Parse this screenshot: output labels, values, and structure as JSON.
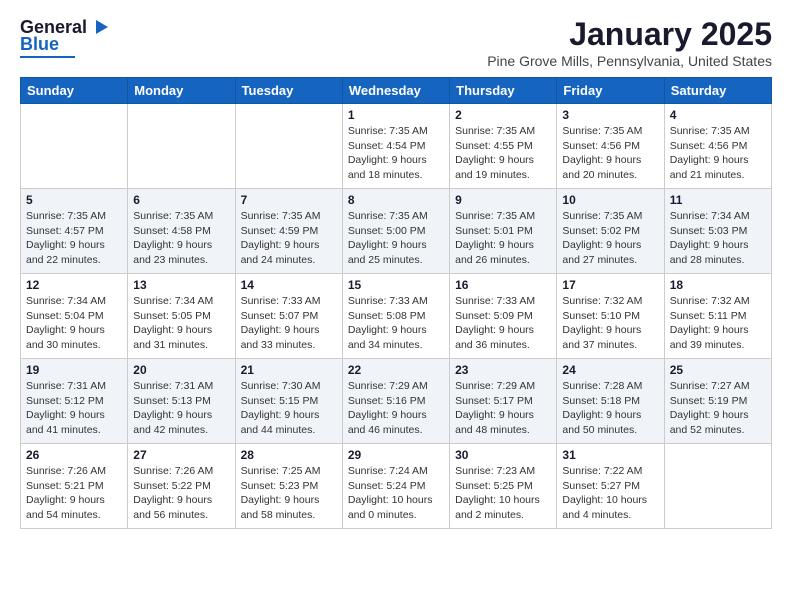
{
  "header": {
    "logo": {
      "line1": "General",
      "line2": "Blue"
    },
    "title": "January 2025",
    "subtitle": "Pine Grove Mills, Pennsylvania, United States"
  },
  "weekdays": [
    "Sunday",
    "Monday",
    "Tuesday",
    "Wednesday",
    "Thursday",
    "Friday",
    "Saturday"
  ],
  "weeks": [
    [
      {
        "day": "",
        "info": ""
      },
      {
        "day": "",
        "info": ""
      },
      {
        "day": "",
        "info": ""
      },
      {
        "day": "1",
        "info": "Sunrise: 7:35 AM\nSunset: 4:54 PM\nDaylight: 9 hours and 18 minutes."
      },
      {
        "day": "2",
        "info": "Sunrise: 7:35 AM\nSunset: 4:55 PM\nDaylight: 9 hours and 19 minutes."
      },
      {
        "day": "3",
        "info": "Sunrise: 7:35 AM\nSunset: 4:56 PM\nDaylight: 9 hours and 20 minutes."
      },
      {
        "day": "4",
        "info": "Sunrise: 7:35 AM\nSunset: 4:56 PM\nDaylight: 9 hours and 21 minutes."
      }
    ],
    [
      {
        "day": "5",
        "info": "Sunrise: 7:35 AM\nSunset: 4:57 PM\nDaylight: 9 hours and 22 minutes."
      },
      {
        "day": "6",
        "info": "Sunrise: 7:35 AM\nSunset: 4:58 PM\nDaylight: 9 hours and 23 minutes."
      },
      {
        "day": "7",
        "info": "Sunrise: 7:35 AM\nSunset: 4:59 PM\nDaylight: 9 hours and 24 minutes."
      },
      {
        "day": "8",
        "info": "Sunrise: 7:35 AM\nSunset: 5:00 PM\nDaylight: 9 hours and 25 minutes."
      },
      {
        "day": "9",
        "info": "Sunrise: 7:35 AM\nSunset: 5:01 PM\nDaylight: 9 hours and 26 minutes."
      },
      {
        "day": "10",
        "info": "Sunrise: 7:35 AM\nSunset: 5:02 PM\nDaylight: 9 hours and 27 minutes."
      },
      {
        "day": "11",
        "info": "Sunrise: 7:34 AM\nSunset: 5:03 PM\nDaylight: 9 hours and 28 minutes."
      }
    ],
    [
      {
        "day": "12",
        "info": "Sunrise: 7:34 AM\nSunset: 5:04 PM\nDaylight: 9 hours and 30 minutes."
      },
      {
        "day": "13",
        "info": "Sunrise: 7:34 AM\nSunset: 5:05 PM\nDaylight: 9 hours and 31 minutes."
      },
      {
        "day": "14",
        "info": "Sunrise: 7:33 AM\nSunset: 5:07 PM\nDaylight: 9 hours and 33 minutes."
      },
      {
        "day": "15",
        "info": "Sunrise: 7:33 AM\nSunset: 5:08 PM\nDaylight: 9 hours and 34 minutes."
      },
      {
        "day": "16",
        "info": "Sunrise: 7:33 AM\nSunset: 5:09 PM\nDaylight: 9 hours and 36 minutes."
      },
      {
        "day": "17",
        "info": "Sunrise: 7:32 AM\nSunset: 5:10 PM\nDaylight: 9 hours and 37 minutes."
      },
      {
        "day": "18",
        "info": "Sunrise: 7:32 AM\nSunset: 5:11 PM\nDaylight: 9 hours and 39 minutes."
      }
    ],
    [
      {
        "day": "19",
        "info": "Sunrise: 7:31 AM\nSunset: 5:12 PM\nDaylight: 9 hours and 41 minutes."
      },
      {
        "day": "20",
        "info": "Sunrise: 7:31 AM\nSunset: 5:13 PM\nDaylight: 9 hours and 42 minutes."
      },
      {
        "day": "21",
        "info": "Sunrise: 7:30 AM\nSunset: 5:15 PM\nDaylight: 9 hours and 44 minutes."
      },
      {
        "day": "22",
        "info": "Sunrise: 7:29 AM\nSunset: 5:16 PM\nDaylight: 9 hours and 46 minutes."
      },
      {
        "day": "23",
        "info": "Sunrise: 7:29 AM\nSunset: 5:17 PM\nDaylight: 9 hours and 48 minutes."
      },
      {
        "day": "24",
        "info": "Sunrise: 7:28 AM\nSunset: 5:18 PM\nDaylight: 9 hours and 50 minutes."
      },
      {
        "day": "25",
        "info": "Sunrise: 7:27 AM\nSunset: 5:19 PM\nDaylight: 9 hours and 52 minutes."
      }
    ],
    [
      {
        "day": "26",
        "info": "Sunrise: 7:26 AM\nSunset: 5:21 PM\nDaylight: 9 hours and 54 minutes."
      },
      {
        "day": "27",
        "info": "Sunrise: 7:26 AM\nSunset: 5:22 PM\nDaylight: 9 hours and 56 minutes."
      },
      {
        "day": "28",
        "info": "Sunrise: 7:25 AM\nSunset: 5:23 PM\nDaylight: 9 hours and 58 minutes."
      },
      {
        "day": "29",
        "info": "Sunrise: 7:24 AM\nSunset: 5:24 PM\nDaylight: 10 hours and 0 minutes."
      },
      {
        "day": "30",
        "info": "Sunrise: 7:23 AM\nSunset: 5:25 PM\nDaylight: 10 hours and 2 minutes."
      },
      {
        "day": "31",
        "info": "Sunrise: 7:22 AM\nSunset: 5:27 PM\nDaylight: 10 hours and 4 minutes."
      },
      {
        "day": "",
        "info": ""
      }
    ]
  ]
}
